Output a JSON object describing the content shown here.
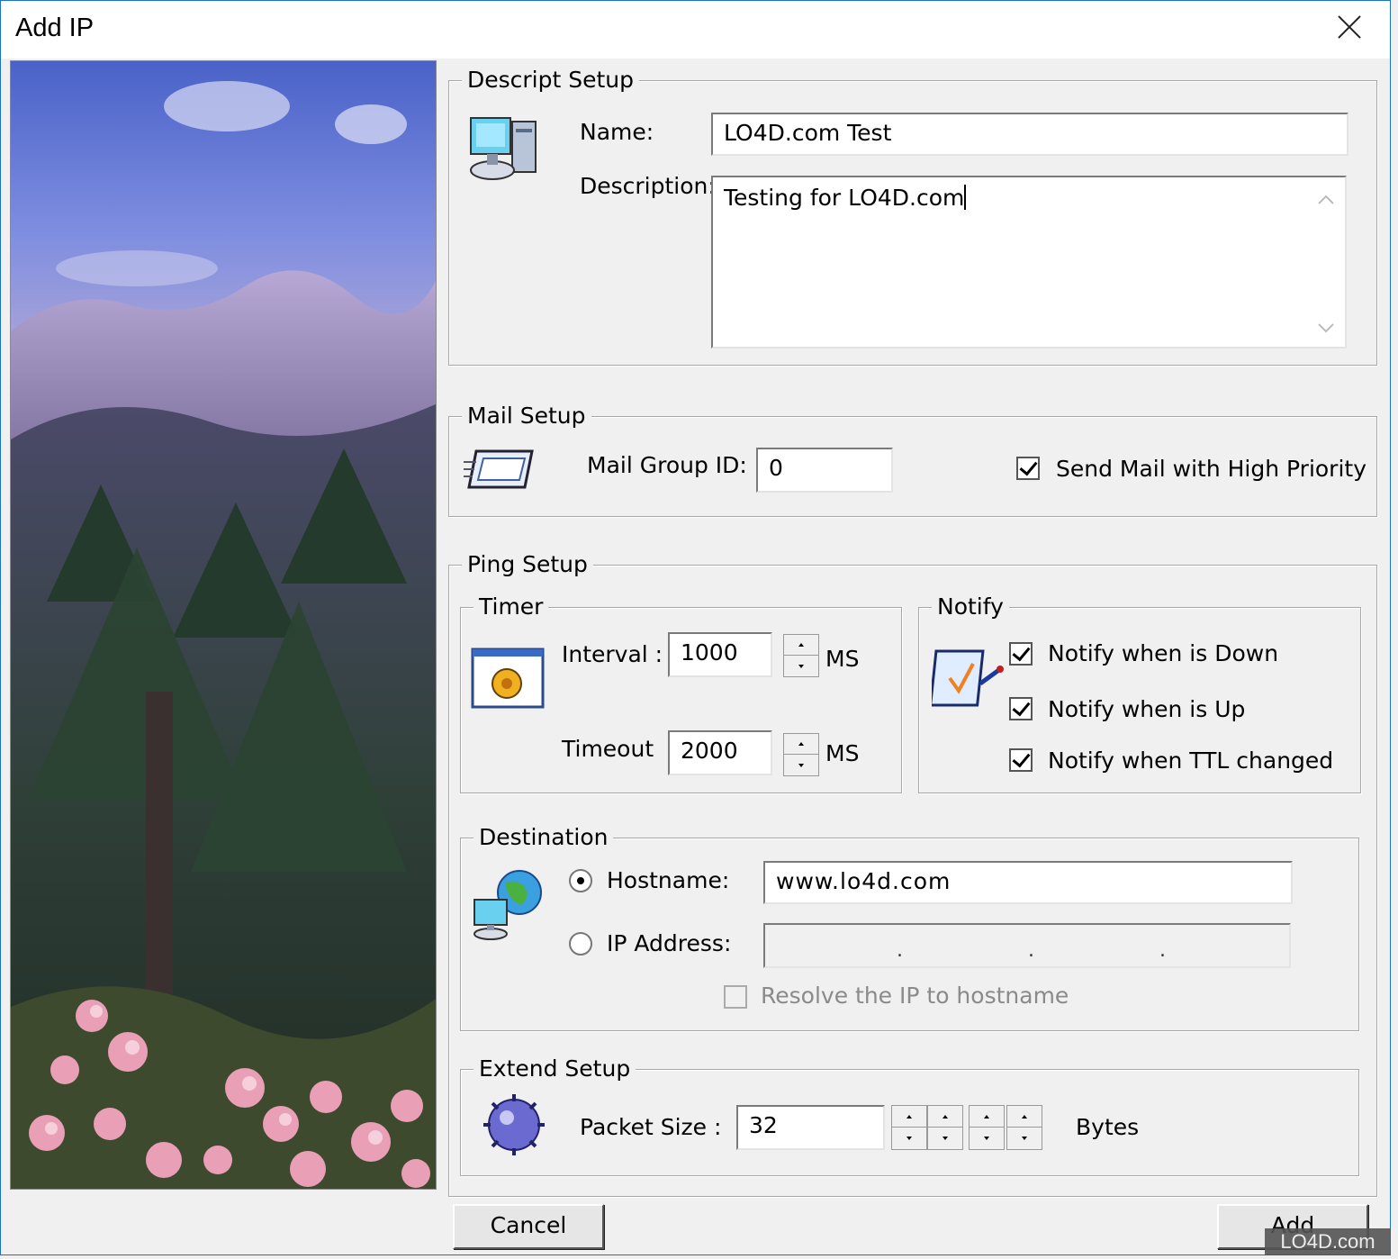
{
  "window": {
    "title": "Add IP"
  },
  "descript": {
    "group_label": "Descript  Setup",
    "name_label": "Name:",
    "name_value": "LO4D.com Test",
    "desc_label": "Description:",
    "desc_value": "Testing for LO4D.com"
  },
  "mail": {
    "group_label": "Mail  Setup",
    "group_id_label": "Mail Group ID:",
    "group_id_value": "0",
    "high_priority_label": "Send Mail with High Priority",
    "high_priority_checked": true
  },
  "ping": {
    "group_label": "Ping  Setup",
    "timer": {
      "group_label": "Timer",
      "interval_label": "Interval :",
      "interval_value": "1000",
      "interval_unit": "MS",
      "timeout_label": "Timeout",
      "timeout_value": "2000",
      "timeout_unit": "MS"
    },
    "notify": {
      "group_label": "Notify",
      "down_label": "Notify when is Down",
      "up_label": "Notify when is Up",
      "ttl_label": "Notify when TTL changed"
    }
  },
  "destination": {
    "group_label": "Destination",
    "hostname_label": "Hostname:",
    "hostname_value": "www.lo4d.com",
    "ip_label": "IP Address:",
    "resolve_label": "Resolve the IP to hostname"
  },
  "extend": {
    "group_label": "Extend Setup",
    "packet_label": "Packet Size :",
    "packet_value": "32",
    "packet_unit": "Bytes"
  },
  "buttons": {
    "cancel": "Cancel",
    "add": "Add"
  },
  "watermark": "LO4D.com"
}
